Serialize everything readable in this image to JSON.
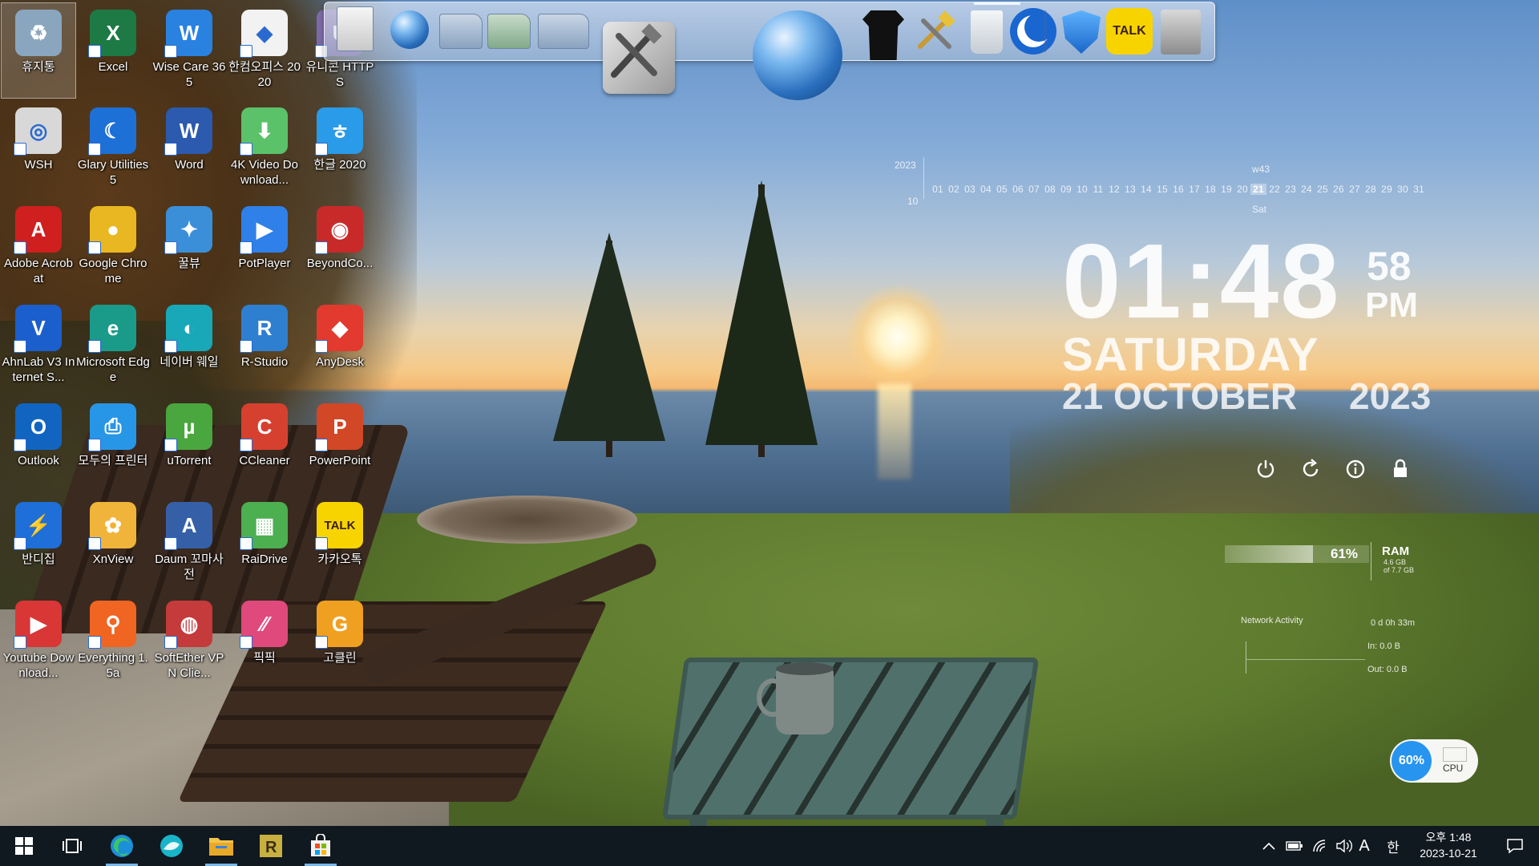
{
  "desktop_icons": [
    {
      "label": "휴지통",
      "color": "#8aa6bf",
      "glyph": "♻",
      "selected": true,
      "shortcut": false
    },
    {
      "label": "Excel",
      "color": "#1d7a44",
      "glyph": "X"
    },
    {
      "label": "Wise Care 365",
      "color": "#2a82e0",
      "glyph": "W"
    },
    {
      "label": "한컴오피스 2020",
      "color": "#f2f2f2",
      "glyph": "◆"
    },
    {
      "label": "유니콘 HTTPS",
      "color": "#7d6aa8",
      "glyph": "U"
    },
    {
      "label": "WSH",
      "color": "#d8d8d8",
      "glyph": "◎"
    },
    {
      "label": "Glary Utilities 5",
      "color": "#1d70d6",
      "glyph": "☾"
    },
    {
      "label": "Word",
      "color": "#2b5aae",
      "glyph": "W"
    },
    {
      "label": "4K Video Download...",
      "color": "#5bc26a",
      "glyph": "⬇"
    },
    {
      "label": "한글 2020",
      "color": "#2a9be8",
      "glyph": "ㅎ"
    },
    {
      "label": "Adobe Acrobat",
      "color": "#cf1f1f",
      "glyph": "A"
    },
    {
      "label": "Google Chrome",
      "color": "#e9b721",
      "glyph": "●"
    },
    {
      "label": "꿀뷰",
      "color": "#3b8fd9",
      "glyph": "✦"
    },
    {
      "label": "PotPlayer",
      "color": "#2f80e8",
      "glyph": "▶"
    },
    {
      "label": "BeyondCo...",
      "color": "#c82a2a",
      "glyph": "◉"
    },
    {
      "label": "AhnLab V3 Internet S...",
      "color": "#1b5fcc",
      "glyph": "V"
    },
    {
      "label": "Microsoft Edge",
      "color": "#1a9b8a",
      "glyph": "e"
    },
    {
      "label": "네이버 웨일",
      "color": "#18a8b8",
      "glyph": "◐"
    },
    {
      "label": "R-Studio",
      "color": "#2f7fd0",
      "glyph": "R"
    },
    {
      "label": "AnyDesk",
      "color": "#e23a2e",
      "glyph": "◆"
    },
    {
      "label": "Outlook",
      "color": "#1165c1",
      "glyph": "O"
    },
    {
      "label": "모두의 프린터",
      "color": "#2896e6",
      "glyph": "⎙"
    },
    {
      "label": "uTorrent",
      "color": "#4aa63e",
      "glyph": "µ"
    },
    {
      "label": "CCleaner",
      "color": "#d6412f",
      "glyph": "C"
    },
    {
      "label": "PowerPoint",
      "color": "#d24726",
      "glyph": "P"
    },
    {
      "label": "반디집",
      "color": "#1f6fd8",
      "glyph": "⚡"
    },
    {
      "label": "XnView",
      "color": "#f1b43a",
      "glyph": "✿"
    },
    {
      "label": "Daum 꼬마사전",
      "color": "#3560a8",
      "glyph": "A"
    },
    {
      "label": "RaiDrive",
      "color": "#4caf50",
      "glyph": "▦"
    },
    {
      "label": "카카오톡",
      "color": "#f7d400",
      "glyph": "TALK"
    },
    {
      "label": "Youtube Download...",
      "color": "#d93636",
      "glyph": "▶"
    },
    {
      "label": "Everything 1.5a",
      "color": "#f16522",
      "glyph": "⚲"
    },
    {
      "label": "SoftEther VPN Clie...",
      "color": "#c53a3a",
      "glyph": "◍"
    },
    {
      "label": "픽픽",
      "color": "#e0497b",
      "glyph": "⁄⁄"
    },
    {
      "label": "고클린",
      "color": "#f0a020",
      "glyph": "G"
    }
  ],
  "dock": {
    "items": [
      {
        "name": "notepad",
        "label": ""
      },
      {
        "name": "network-globe",
        "label": ""
      },
      {
        "name": "folder",
        "label": ""
      },
      {
        "name": "green-folder",
        "label": ""
      },
      {
        "name": "image-folder",
        "label": ""
      },
      {
        "name": "system-tools",
        "label": ""
      },
      {
        "name": "globe-browser",
        "label": ""
      },
      {
        "name": "shirt",
        "label": ""
      },
      {
        "name": "hammer-tools",
        "label": ""
      },
      {
        "name": "recycle-bin",
        "label": ""
      },
      {
        "name": "glary-moon",
        "label": ""
      },
      {
        "name": "wise-shield",
        "label": ""
      },
      {
        "name": "kakaotalk",
        "label": "TALK"
      },
      {
        "name": "r-studio-server",
        "label": ""
      }
    ]
  },
  "calendar": {
    "year": "2023",
    "month": "10",
    "week": "w43",
    "weekday": "Sat",
    "days": [
      "01",
      "02",
      "03",
      "04",
      "05",
      "06",
      "07",
      "08",
      "09",
      "10",
      "11",
      "12",
      "13",
      "14",
      "15",
      "16",
      "17",
      "18",
      "19",
      "20",
      "21",
      "22",
      "23",
      "24",
      "25",
      "26",
      "27",
      "28",
      "29",
      "30",
      "31"
    ],
    "today": "21"
  },
  "clock": {
    "time": "01:48",
    "seconds": "58",
    "ampm": "PM",
    "day": "SATURDAY",
    "date": "21 OCTOBER",
    "year": "2023"
  },
  "power_buttons": [
    "power",
    "restart",
    "info",
    "lock"
  ],
  "ram": {
    "percent_text": "61%",
    "percent": 61,
    "label": "RAM",
    "detail_line1": "4.6 GB",
    "detail_line2": "of 7.7 GB"
  },
  "network": {
    "title": "Network Activity",
    "uptime": "0 d 0h 33m",
    "in": "In: 0.0 B",
    "out": "Out: 0.0 B"
  },
  "cpu": {
    "percent_text": "60%",
    "label": "CPU"
  },
  "taskbar": {
    "clock_line1": "오후 1:48",
    "clock_line2": "2023-10-21",
    "ime_letter": "A",
    "ime_korean": "한"
  }
}
